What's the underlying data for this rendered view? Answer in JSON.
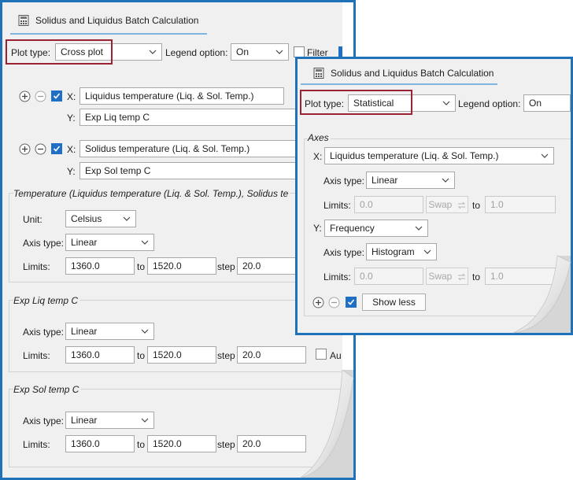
{
  "back_panel": {
    "tab_title": "Solidus and Liquidus Batch Calculation",
    "plot_type_label": "Plot type:",
    "plot_type_value": "Cross plot",
    "legend_option_label": "Legend option:",
    "legend_option_value": "On",
    "filter_label": "Filter",
    "series": [
      {
        "x_label": "X:",
        "x_value": "Liquidus temperature (Liq. & Sol. Temp.)",
        "y_label": "Y:",
        "y_value": "Exp Liq temp C"
      },
      {
        "x_label": "X:",
        "x_value": "Solidus temperature (Liq. & Sol. Temp.)",
        "y_label": "Y:",
        "y_value": "Exp Sol temp C"
      }
    ],
    "temperature_section": {
      "title": "Temperature (Liquidus temperature (Liq. & Sol. Temp.), Solidus te",
      "unit_label": "Unit:",
      "unit_value": "Celsius",
      "axis_type_label": "Axis type:",
      "axis_type_value": "Linear",
      "limits_label": "Limits:",
      "from": "1360.0",
      "to_label": "to",
      "to": "1520.0",
      "step_label": "step",
      "step": "20.0"
    },
    "liq_section": {
      "title": "Exp Liq temp C",
      "axis_type_label": "Axis type:",
      "axis_type_value": "Linear",
      "limits_label": "Limits:",
      "from": "1360.0",
      "to_label": "to",
      "to": "1520.0",
      "step_label": "step",
      "step": "20.0",
      "auto_label": "Au"
    },
    "sol_section": {
      "title": "Exp Sol temp C",
      "axis_type_label": "Axis type:",
      "axis_type_value": "Linear",
      "limits_label": "Limits:",
      "from": "1360.0",
      "to_label": "to",
      "to": "1520.0",
      "step_label": "step",
      "step": "20.0"
    }
  },
  "front_panel": {
    "tab_title": "Solidus and Liquidus Batch Calculation",
    "plot_type_label": "Plot type:",
    "plot_type_value": "Statistical",
    "legend_option_label": "Legend option:",
    "legend_option_value": "On",
    "axes_title": "Axes",
    "x_label": "X:",
    "x_value": "Liquidus temperature (Liq. & Sol. Temp.)",
    "x_axis_type_label": "Axis type:",
    "x_axis_type_value": "Linear",
    "x_limits_label": "Limits:",
    "x_from": "0.0",
    "swap_label": "Swap",
    "to_label": "to",
    "x_to": "1.0",
    "y_label": "Y:",
    "y_value": "Frequency",
    "y_axis_type_label": "Axis type:",
    "y_axis_type_value": "Histogram",
    "y_limits_label": "Limits:",
    "y_from": "0.0",
    "y_to": "1.0",
    "show_less_label": "Show less"
  },
  "colors": {
    "frame_blue": "#1f72b8",
    "highlight_red": "#9b2335",
    "checkbox_blue": "#1f6fc5",
    "panel_gray": "#f0f0f0"
  }
}
